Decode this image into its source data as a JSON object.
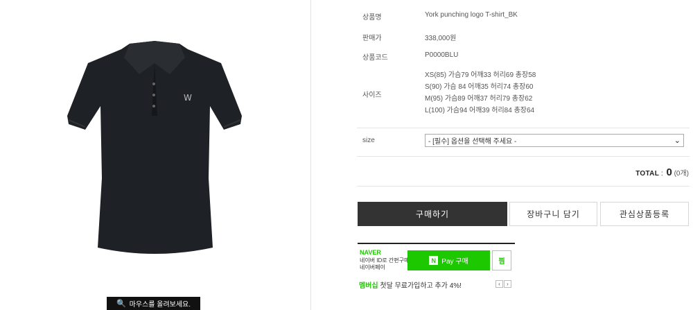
{
  "product": {
    "name_label": "상품명",
    "name_value": "York punching logo T-shirt_BK",
    "price_label": "판매가",
    "price_value": "338,000원",
    "code_label": "상품코드",
    "code_value": "P0000BLU",
    "size_label": "사이즈",
    "size_lines": [
      "XS(85) 가슴79 어깨33 허리69 총장58",
      "S(90) 가슴 84 어깨35 허리74 총장60",
      "M(95) 가슴89 어깨37 허리79 총장62",
      "L(100) 가슴94 어깨39 허리84 총장64"
    ]
  },
  "option": {
    "label": "size",
    "selected": "- [필수] 옵션을 선택해 주세요 -"
  },
  "total": {
    "label": "TOTAL",
    "separator": ":",
    "value": "0",
    "count": "(0개)"
  },
  "buttons": {
    "buy": "구매하기",
    "cart": "장바구니 담기",
    "wish": "관심상품등록"
  },
  "naver_pay": {
    "brand": "NAVER",
    "sub_line1": "네이버 ID로 간편구매",
    "sub_line2": "네이버페이",
    "pay_n": "N",
    "pay_label": "Pay 구매",
    "zzim": "찜"
  },
  "membership": {
    "highlight": "멤버십",
    "text": " 첫달 무료가입하고 추가 4%!"
  },
  "zoom": {
    "label": "마우스를 올려보세요."
  },
  "icons": {
    "magnifier": "magnifier-icon",
    "select_arrow": "chevron-down-icon"
  },
  "colors": {
    "buy_button": "#333333",
    "naver_green": "#1ec800"
  }
}
